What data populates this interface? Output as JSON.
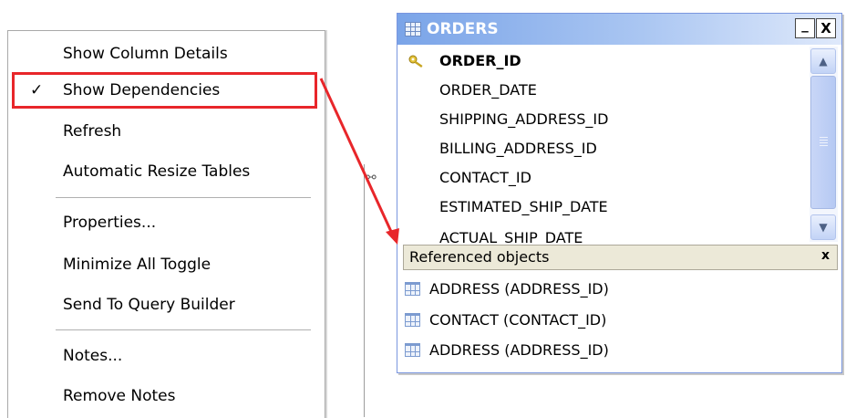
{
  "menu": {
    "items": [
      {
        "label": "Show Column Details",
        "checked": false
      },
      {
        "label": "Show Dependencies",
        "checked": true
      },
      {
        "label": "Refresh",
        "checked": false
      },
      {
        "label": "Automatic Resize Tables",
        "checked": false
      },
      {
        "label": "Properties...",
        "checked": false
      },
      {
        "label": "Minimize All Toggle",
        "checked": false
      },
      {
        "label": "Send To Query Builder",
        "checked": false
      },
      {
        "label": "Notes...",
        "checked": false
      },
      {
        "label": "Remove Notes",
        "checked": false
      }
    ],
    "check_glyph": "✓"
  },
  "table_window": {
    "title": "ORDERS",
    "minimize_glyph": "_",
    "close_glyph": "X",
    "columns": [
      {
        "name": "ORDER_ID",
        "primary_key": true
      },
      {
        "name": "ORDER_DATE",
        "primary_key": false
      },
      {
        "name": "SHIPPING_ADDRESS_ID",
        "primary_key": false
      },
      {
        "name": "BILLING_ADDRESS_ID",
        "primary_key": false
      },
      {
        "name": "CONTACT_ID",
        "primary_key": false
      },
      {
        "name": "ESTIMATED_SHIP_DATE",
        "primary_key": false
      },
      {
        "name": "ACTUAL_SHIP_DATE",
        "primary_key": false
      }
    ],
    "referenced_objects": {
      "title": "Referenced objects",
      "close_glyph": "x",
      "items": [
        "ADDRESS (ADDRESS_ID)",
        "CONTACT (CONTACT_ID)",
        "ADDRESS (ADDRESS_ID)"
      ]
    }
  },
  "colors": {
    "highlight": "#e8262a",
    "title_bar": "#7aa4e8",
    "panel": "#ece9d8"
  },
  "icons": {
    "title": "table-icon",
    "primary_key": "key-icon",
    "link": "link-icon",
    "referenced": "table-icon"
  }
}
